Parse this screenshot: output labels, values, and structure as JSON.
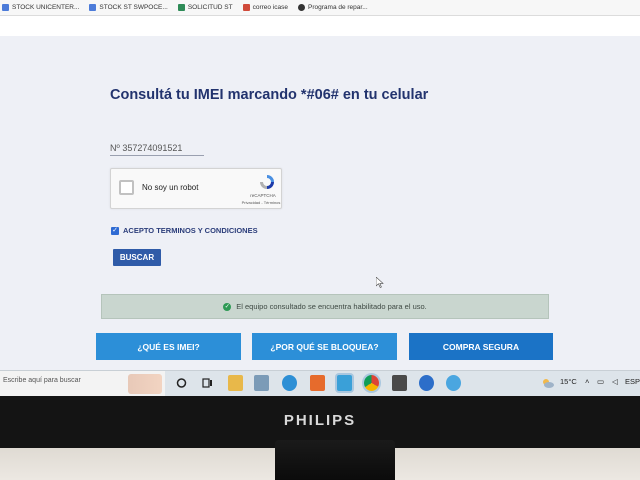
{
  "bookmarks": [
    {
      "label": "STOCK UNICENTER..."
    },
    {
      "label": "STOCK ST SWPOCE..."
    },
    {
      "label": "SOLICITUD ST"
    },
    {
      "label": "correo icase"
    },
    {
      "label": "Programa de repar..."
    }
  ],
  "page": {
    "title": "Consultá tu IMEI marcando *#06# en tu celular",
    "imei_prefix": "Nº",
    "imei_value": "357274091521",
    "captcha": {
      "label": "No soy un robot",
      "brand": "reCAPTCHA",
      "links": "Privacidad - Términos"
    },
    "terms_label": "ACEPTO TERMINOS Y CONDICIONES",
    "search_label": "BUSCAR",
    "result_text": "El equipo consultado se encuentra habilitado para el uso.",
    "nav": {
      "what_is": "¿QUÉ ES IMEI?",
      "why_blocked": "¿POR QUÉ SE BLOQUEA?",
      "secure_purchase": "COMPRA SEGURA"
    }
  },
  "taskbar": {
    "search_placeholder": "Escribe aquí para buscar",
    "temperature": "15°C",
    "language": "ESP"
  },
  "monitor": {
    "brand": "PHILIPS"
  },
  "colors": {
    "title": "#22336e",
    "accent": "#2c8fd8",
    "search_button": "#2f5ba8",
    "success_bar": "#c9d6cf"
  }
}
